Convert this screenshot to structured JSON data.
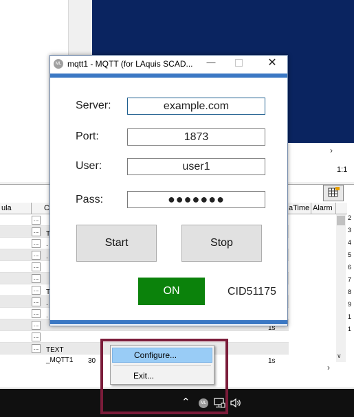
{
  "background_app": {
    "zoom_ratio": "1:1",
    "grid": {
      "headers": [
        "ula",
        "C",
        "aTime",
        "Alarm"
      ],
      "rows": [
        {
          "text": "T"
        },
        {
          "text": "."
        },
        {
          "text": "."
        },
        {
          "text": ""
        },
        {
          "text": ""
        },
        {
          "text": "T"
        },
        {
          "text": "."
        },
        {
          "text": "."
        },
        {
          "text": ""
        },
        {
          "text": ""
        },
        {
          "text": "TEXT"
        },
        {
          "text": "_MQTT1"
        }
      ],
      "cell_values": [
        "1s",
        "30",
        "1s"
      ],
      "row_numbers": [
        "2",
        "3",
        "4",
        "5",
        "6",
        "7",
        "8",
        "9",
        "1",
        "1"
      ]
    }
  },
  "dialog": {
    "title": "mqtt1 - MQTT (for LAquis SCAD...",
    "app_icon": "ML",
    "fields": {
      "server": {
        "label": "Server:",
        "value": "example.com"
      },
      "port": {
        "label": "Port:",
        "value": "1873"
      },
      "user": {
        "label": "User:",
        "value": "user1"
      },
      "pass": {
        "label": "Pass:",
        "value": "●●●●●●●"
      }
    },
    "buttons": {
      "start": "Start",
      "stop": "Stop"
    },
    "status": {
      "label": "ON",
      "color": "#0b820b"
    },
    "client_id": "CID51175"
  },
  "context_menu": {
    "items": [
      {
        "label": "Configure...",
        "highlighted": true
      },
      {
        "label": "Exit...",
        "highlighted": false
      }
    ]
  },
  "taskbar": {
    "tray_icons": [
      "show-hidden-icons-chevron",
      "laquis-ml-icon",
      "network-icon",
      "volume-icon"
    ],
    "tray_app_icon_label": "ML"
  },
  "colors": {
    "dialog_accent": "#3b78c4",
    "highlight_box": "#7b1c3a",
    "menu_highlight": "#99ccf6",
    "taskbar": "#101010"
  }
}
